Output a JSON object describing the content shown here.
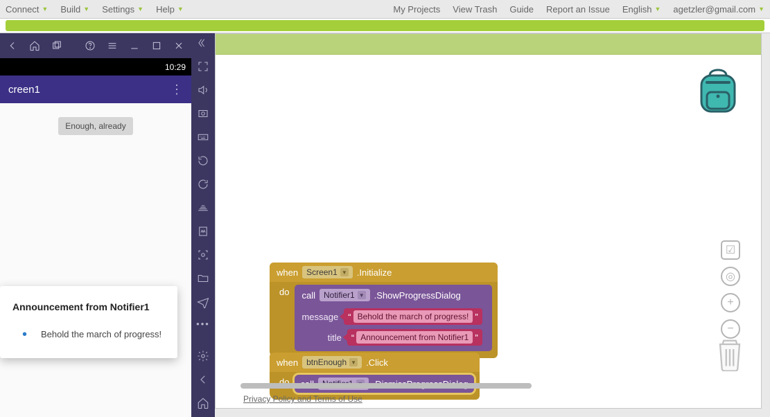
{
  "topmenu": {
    "left": [
      "Connect",
      "Build",
      "Settings",
      "Help"
    ],
    "right": [
      "My Projects",
      "View Trash",
      "Guide",
      "Report an Issue"
    ],
    "language": "English",
    "user": "agetzler@gmail.com"
  },
  "phone": {
    "time": "10:29",
    "screenTitle": "creen1",
    "buttonLabel": "Enough, already"
  },
  "dialog": {
    "title": "Announcement from Notifier1",
    "message": "Behold the march of progress!"
  },
  "blocks": {
    "event1": {
      "when": "when",
      "component": "Screen1",
      "event": ".Initialize",
      "do": "do",
      "call": "call",
      "callComponent": "Notifier1",
      "method": ".ShowProgressDialog",
      "param1": "message",
      "param2": "title",
      "text1": "Behold the march of progress!",
      "text2": "Announcement from Notifier1"
    },
    "event2": {
      "when": "when",
      "component": "btnEnough",
      "event": ".Click",
      "do": "do",
      "call": "call",
      "callComponent": "Notifier1",
      "method": ".DismissProgressDialog"
    }
  },
  "footer": {
    "privacy": "Privacy Policy and Terms of Use"
  }
}
